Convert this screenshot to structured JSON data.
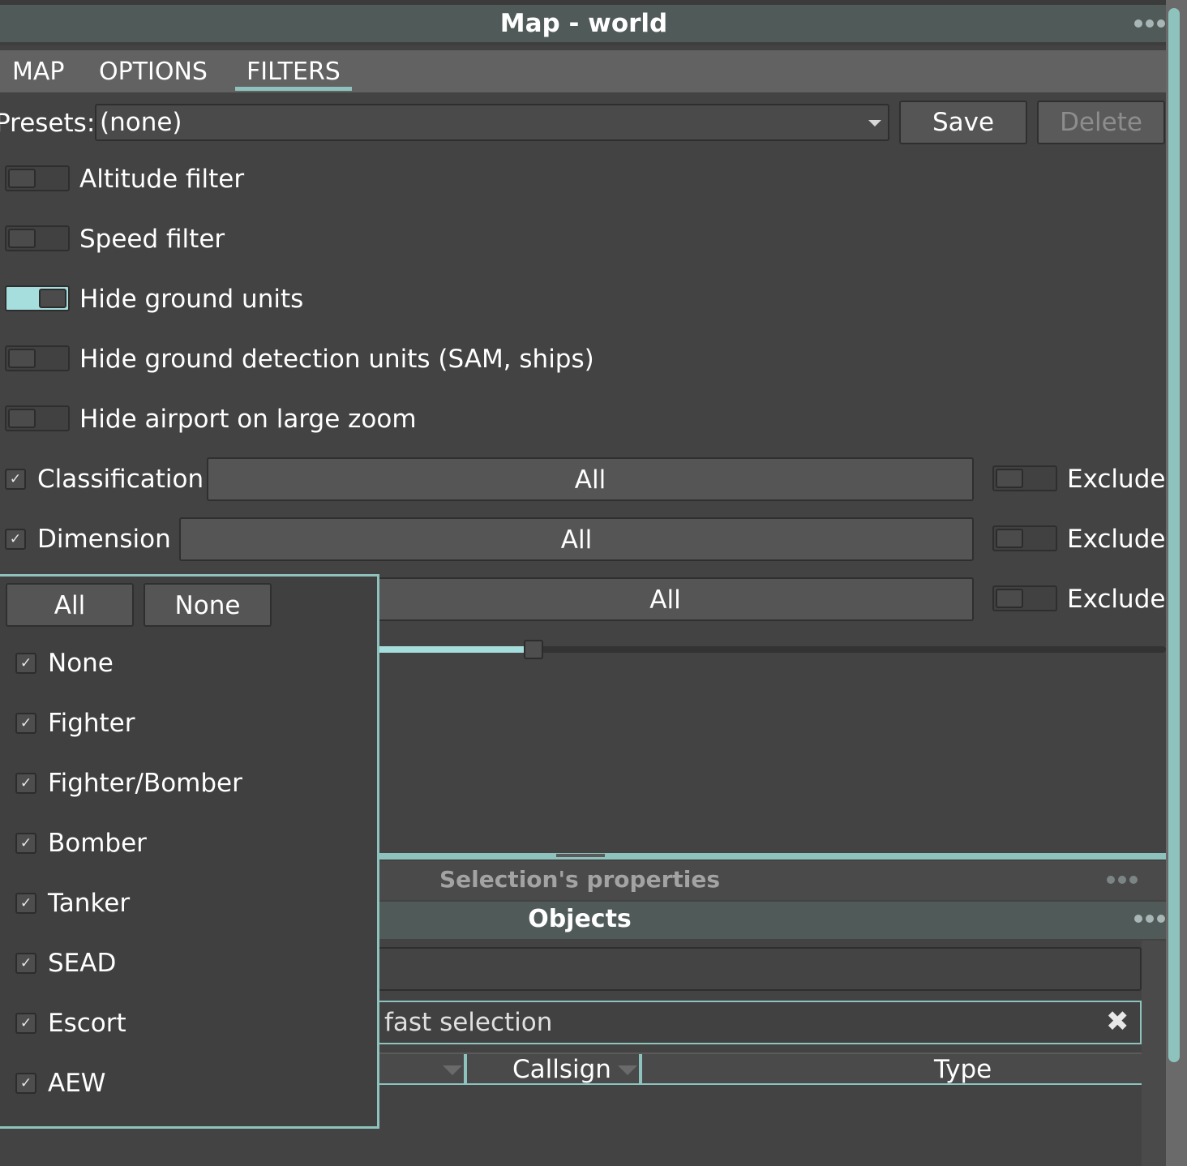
{
  "window": {
    "title": "Map - world",
    "menu_icon": "more-dots-icon"
  },
  "tabs": [
    {
      "label": "MAP",
      "active": false
    },
    {
      "label": "OPTIONS",
      "active": false
    },
    {
      "label": "FILTERS",
      "active": true
    }
  ],
  "presets": {
    "label": "Presets:",
    "value": "(none)",
    "save_label": "Save",
    "delete_label": "Delete"
  },
  "toggles": [
    {
      "label": "Altitude filter",
      "on": false
    },
    {
      "label": "Speed filter",
      "on": false
    },
    {
      "label": "Hide ground units",
      "on": true
    },
    {
      "label": "Hide ground detection units (SAM, ships)",
      "on": false
    },
    {
      "label": "Hide airport on large zoom",
      "on": false
    }
  ],
  "filters": [
    {
      "label": "Classification",
      "checked": true,
      "value": "All",
      "exclude_label": "Exclude"
    },
    {
      "label": "Dimension",
      "checked": true,
      "value": "All",
      "exclude_label": "Exclude"
    },
    {
      "label": "",
      "checked": true,
      "value": "All",
      "exclude_label": "Exclude"
    }
  ],
  "popup": {
    "all_label": "All",
    "none_label": "None",
    "items": [
      {
        "label": "None",
        "checked": true
      },
      {
        "label": "Fighter",
        "checked": true
      },
      {
        "label": "Fighter/Bomber",
        "checked": true
      },
      {
        "label": "Bomber",
        "checked": true
      },
      {
        "label": "Tanker",
        "checked": true
      },
      {
        "label": "SEAD",
        "checked": true
      },
      {
        "label": "Escort",
        "checked": true
      },
      {
        "label": "AEW",
        "checked": true
      }
    ]
  },
  "panels": {
    "selection_properties": "Selection's properties",
    "objects": "Objects",
    "fast_selection_placeholder": "fast selection",
    "columns": [
      "Callsign",
      "Type"
    ]
  },
  "colors": {
    "accent": "#8ec3bd",
    "background": "#434343",
    "toggle_on": "#a5dedd"
  }
}
